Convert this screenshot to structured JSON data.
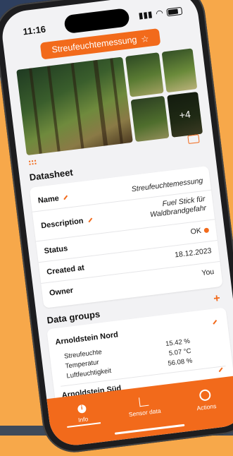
{
  "status": {
    "time": "11:16"
  },
  "header": {
    "title": "Streufeuchtemessung",
    "star": "☆"
  },
  "gallery": {
    "more_label": "+4"
  },
  "datasheet": {
    "title": "Datasheet",
    "rows": [
      {
        "label": "Name",
        "value": "Streufeuchtemessung"
      },
      {
        "label": "Description",
        "value_line1": "Fuel Stick für",
        "value_line2": "Waldbrandgefahr"
      },
      {
        "label": "Status",
        "value": "OK"
      },
      {
        "label": "Created at",
        "value": "18.12.2023"
      },
      {
        "label": "Owner",
        "value": "You"
      }
    ]
  },
  "data_groups": {
    "title": "Data groups",
    "add": "+",
    "groups": [
      {
        "name": "Arnoldstein Nord",
        "items": [
          {
            "label": "Streufeuchte",
            "value": "15.42 %"
          },
          {
            "label": "Temperatur",
            "value": "5.07 °C"
          },
          {
            "label": "Luftfeuchtigkeit",
            "value": "56.08 %"
          }
        ]
      },
      {
        "name": "Arnoldstein Süd"
      }
    ]
  },
  "tabbar": {
    "tabs": [
      {
        "label": "Info",
        "icon": "info-icon"
      },
      {
        "label": "Sensor data",
        "icon": "chart-icon"
      },
      {
        "label": "Actions",
        "icon": "gear-icon"
      }
    ]
  },
  "colors": {
    "accent": "#F26A1B",
    "background": "#F7A84A"
  }
}
